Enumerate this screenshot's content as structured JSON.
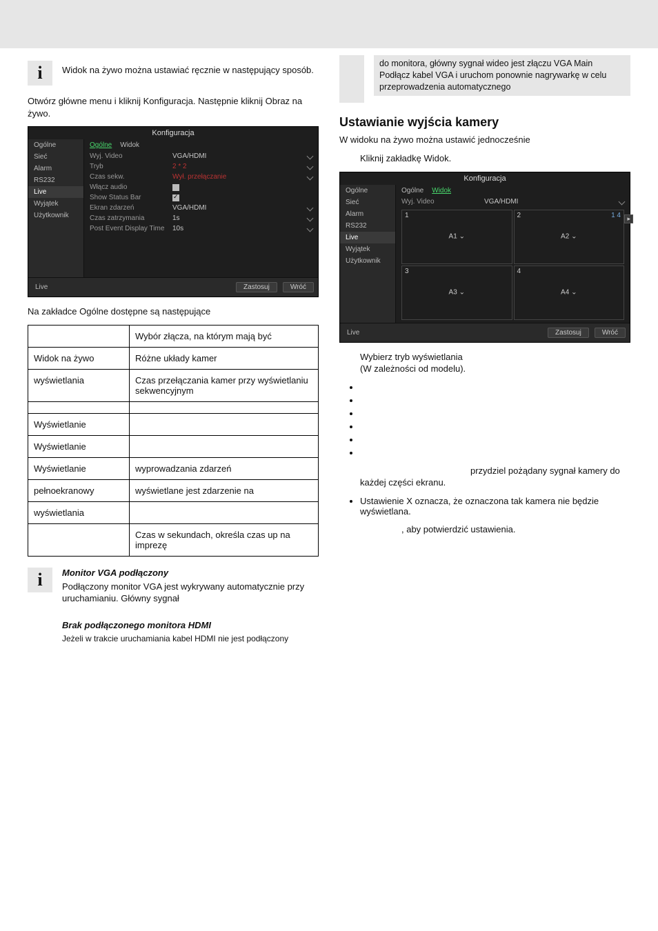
{
  "leftCol": {
    "intro_info": "Widok na żywo można ustawiać ręcznie w następujący sposób.",
    "open_menu": "Otwórz główne menu i kliknij Konfiguracja. Następnie kliknij Obraz na żywo.",
    "nvr1": {
      "title": "Konfiguracja",
      "sidebar": [
        "Ogólne",
        "Sieć",
        "Alarm",
        "RS232",
        "Live",
        "Wyjątek",
        "Użytkownik"
      ],
      "sidebar_active_index": 4,
      "tabs": [
        "Ogólne",
        "Widok"
      ],
      "tab_active_index": 0,
      "rows": [
        {
          "label": "Wyj. Video",
          "value": "VGA/HDMI",
          "red": false,
          "drop": true
        },
        {
          "label": "Tryb",
          "value": "2 * 2",
          "red": true,
          "drop": true
        },
        {
          "label": "Czas sekw.",
          "value": "Wył. przełączanie",
          "red": true,
          "drop": true
        },
        {
          "label": "Włącz audio",
          "check": true,
          "checked": false
        },
        {
          "label": "Show Status Bar",
          "check": true,
          "checked": true
        },
        {
          "label": "Ekran zdarzeń",
          "value": "VGA/HDMI",
          "drop": true
        },
        {
          "label": "Czas zatrzymania",
          "value": "1s",
          "drop": true
        },
        {
          "label": "Post Event Display Time",
          "value": "10s",
          "drop": true
        }
      ],
      "foot_left": "Live",
      "btn_apply": "Zastosuj",
      "btn_back": "Wróć"
    },
    "general_tab_intro": "Na zakładce Ogólne dostępne są następujące",
    "table": [
      {
        "lbl": "",
        "desc": "Wybór złącza, na którym mają być"
      },
      {
        "lbl": "Widok na żywo",
        "desc": "Różne układy kamer"
      },
      {
        "lbl": "wyświetlania",
        "desc": "Czas przełączania kamer przy wyświetlaniu sekwencyjnym"
      },
      {
        "lbl": "",
        "desc": ""
      },
      {
        "lbl": "Wyświetlanie",
        "desc": ""
      },
      {
        "lbl": "Wyświetlanie",
        "desc": ""
      },
      {
        "lbl": "Wyświetlanie",
        "desc": "wyprowadzania zdarzeń"
      },
      {
        "lbl": "pełnoekranowy",
        "desc": "wyświetlane jest zdarzenie na"
      },
      {
        "lbl": "wyświetlania",
        "desc": ""
      },
      {
        "lbl": "",
        "desc": "Czas w sekundach, określa czas up na imprezę"
      }
    ],
    "vga_title": "Monitor VGA podłączony",
    "vga_text": "Podłączony monitor VGA jest wykrywany automatycznie przy uruchamianiu. Główny sygnał",
    "hdmi_title": "Brak podłączonego monitora HDMI",
    "hdmi_text": "Jeżeli w trakcie uruchamiania kabel HDMI nie jest podłączony"
  },
  "rightCol": {
    "gray_top": "do monitora, główny sygnał wideo jest złączu VGA Main Podłącz kabel VGA i uruchom ponownie nagrywarkę w celu przeprowadzenia automatycznego",
    "h2": "Ustawianie wyjścia kamery",
    "h2_sub": "W widoku na żywo można ustawić jednocześnie",
    "click_view_tab": "Kliknij zakładkę Widok.",
    "nvr2": {
      "title": "Konfiguracja",
      "sidebar": [
        "Ogólne",
        "Sieć",
        "Alarm",
        "RS232",
        "Live",
        "Wyjątek",
        "Użytkownik"
      ],
      "sidebar_active_index": 4,
      "tabs": [
        "Ogólne",
        "Widok"
      ],
      "tab_active_index": 1,
      "output_label": "Wyj. Video",
      "output_value": "VGA/HDMI",
      "cells": [
        {
          "n": "1",
          "chip": "A1"
        },
        {
          "n": "2",
          "chip": "A2"
        },
        {
          "n": "3",
          "chip": "A3"
        },
        {
          "n": "4",
          "chip": "A4"
        }
      ],
      "thumbs": "1  4",
      "nav_arrow": "▸",
      "foot_left": "Live",
      "btn_apply": "Zastosuj",
      "btn_back": "Wróć"
    },
    "choose_mode": "Wybierz tryb wyświetlania",
    "choose_mode2": "(W zależności od modelu).",
    "bullets": [
      "",
      "",
      "",
      "",
      "",
      ""
    ],
    "assign_cam": "przydziel pożądany sygnał kamery do każdej części ekranu.",
    "x_setting": "Ustawienie X oznacza, że oznaczona tak kamera nie będzie wyświetlana.",
    "confirm": ", aby potwierdzić ustawienia."
  }
}
